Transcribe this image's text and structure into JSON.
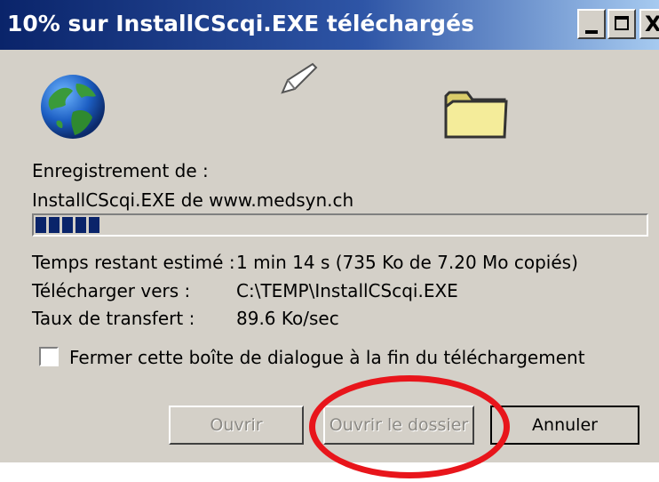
{
  "window": {
    "title": "10% sur InstallCScqi.EXE téléchargés",
    "controls": {
      "minimize_icon": "minimize-icon",
      "maximize_icon": "maximize-icon",
      "close_glyph": "X"
    }
  },
  "icons": {
    "globe": "globe-icon",
    "paper": "flying-paper-icon",
    "folder": "folder-icon"
  },
  "download": {
    "saving_label": "Enregistrement de :",
    "file_source": "InstallCScqi.EXE de www.medsyn.ch",
    "progress_percent": 10,
    "progress_blocks": 5,
    "rows": [
      {
        "label": "Temps restant estimé :",
        "value": "1 min 14 s (735 Ko de 7.20 Mo copiés)"
      },
      {
        "label": "Télécharger vers :",
        "value": "C:\\TEMP\\InstallCScqi.EXE"
      },
      {
        "label": "Taux de transfert :",
        "value": "89.6 Ko/sec"
      }
    ]
  },
  "options": {
    "close_checkbox_label": "Fermer cette boîte de dialogue à la fin du téléchargement",
    "close_checkbox_checked": false
  },
  "buttons": {
    "open": "Ouvrir",
    "open_folder": "Ouvrir le dossier",
    "cancel": "Annuler"
  },
  "colors": {
    "titlebar_start": "#0a246a",
    "titlebar_end": "#a6caf0",
    "dialog_bg": "#d4d0c8",
    "progress_block": "#0a246a",
    "annotation_circle": "#e8151b"
  }
}
